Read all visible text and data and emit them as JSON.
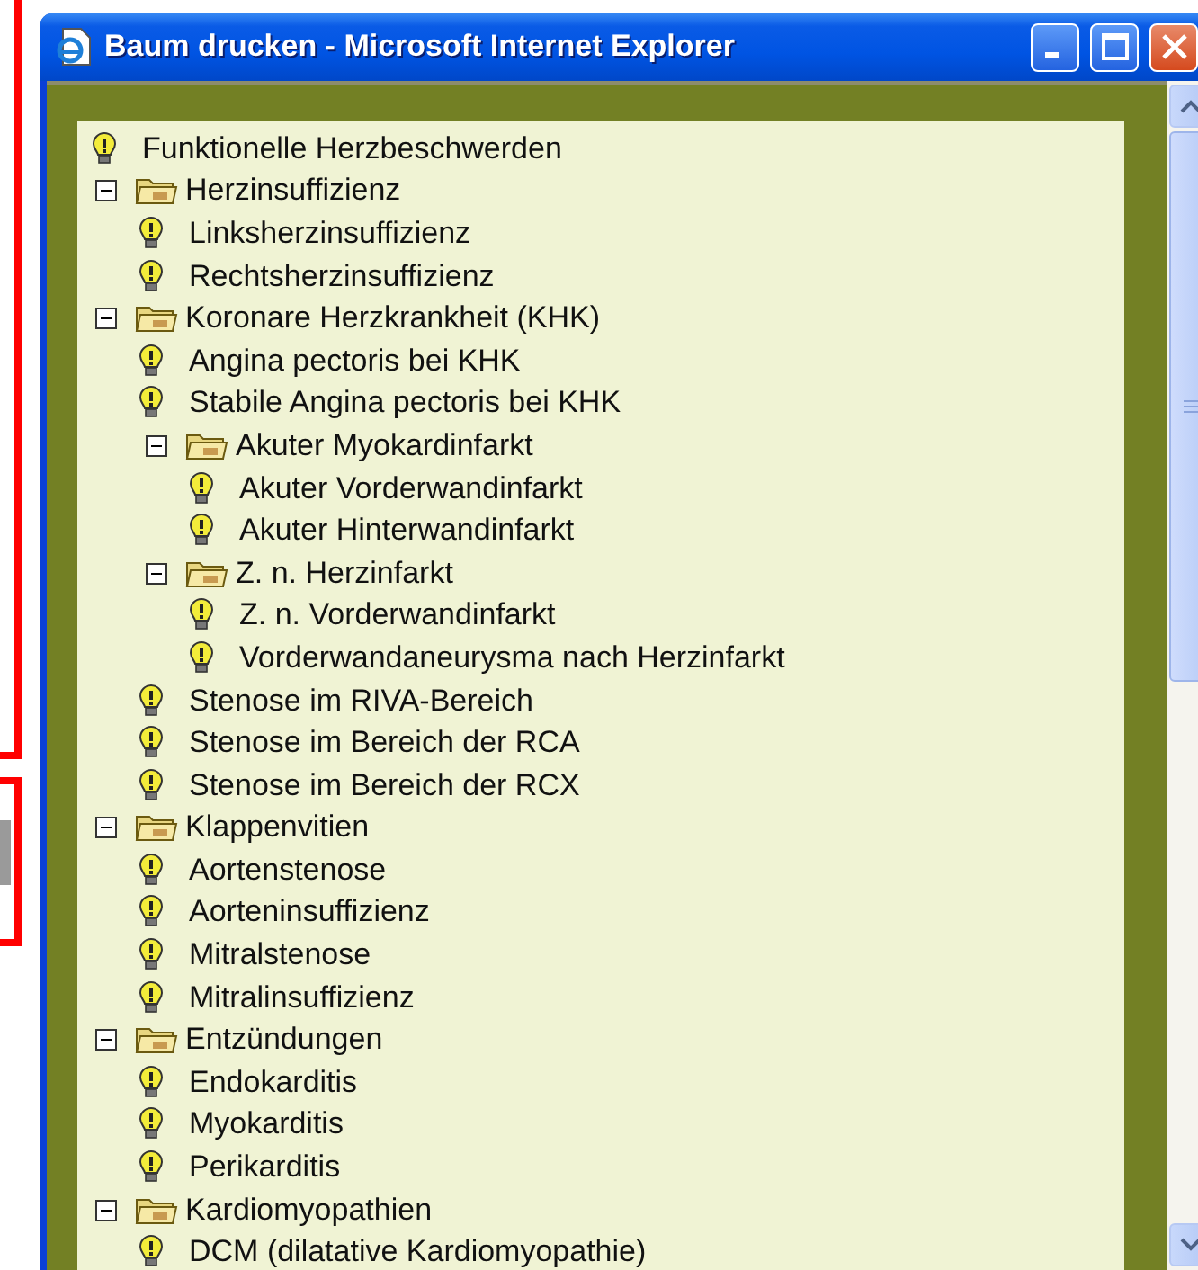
{
  "window": {
    "title": "Baum drucken - Microsoft Internet Explorer"
  },
  "tree": [
    {
      "kind": "leaf",
      "label": "Funktionelle Herzbeschwerden"
    },
    {
      "kind": "folder",
      "label": "Herzinsuffizienz",
      "expanded": true,
      "children": [
        {
          "kind": "leaf",
          "label": "Linksherzinsuffizienz"
        },
        {
          "kind": "leaf",
          "label": "Rechtsherzinsuffizienz"
        }
      ]
    },
    {
      "kind": "folder",
      "label": "Koronare Herzkrankheit (KHK)",
      "expanded": true,
      "children": [
        {
          "kind": "leaf",
          "label": "Angina pectoris bei KHK"
        },
        {
          "kind": "leaf",
          "label": "Stabile Angina pectoris bei KHK"
        },
        {
          "kind": "folder",
          "label": "Akuter Myokardinfarkt",
          "expanded": true,
          "children": [
            {
              "kind": "leaf",
              "label": "Akuter Vorderwandinfarkt"
            },
            {
              "kind": "leaf",
              "label": "Akuter Hinterwandinfarkt"
            }
          ]
        },
        {
          "kind": "folder",
          "label": "Z. n. Herzinfarkt",
          "expanded": true,
          "children": [
            {
              "kind": "leaf",
              "label": "Z. n. Vorderwandinfarkt"
            },
            {
              "kind": "leaf",
              "label": "Vorderwandaneurysma nach Herzinfarkt"
            }
          ]
        },
        {
          "kind": "leaf",
          "label": "Stenose im RIVA-Bereich"
        },
        {
          "kind": "leaf",
          "label": "Stenose im Bereich der RCA"
        },
        {
          "kind": "leaf",
          "label": "Stenose im Bereich der RCX"
        }
      ]
    },
    {
      "kind": "folder",
      "label": "Klappenvitien",
      "expanded": true,
      "children": [
        {
          "kind": "leaf",
          "label": "Aortenstenose"
        },
        {
          "kind": "leaf",
          "label": "Aorteninsuffizienz"
        },
        {
          "kind": "leaf",
          "label": "Mitralstenose"
        },
        {
          "kind": "leaf",
          "label": "Mitralinsuffizienz"
        }
      ]
    },
    {
      "kind": "folder",
      "label": "Entzündungen",
      "expanded": true,
      "children": [
        {
          "kind": "leaf",
          "label": "Endokarditis"
        },
        {
          "kind": "leaf",
          "label": "Myokarditis"
        },
        {
          "kind": "leaf",
          "label": "Perikarditis"
        }
      ]
    },
    {
      "kind": "folder",
      "label": "Kardiomyopathien",
      "expanded": true,
      "children": [
        {
          "kind": "leaf",
          "label": "DCM (dilatative Kardiomyopathie)"
        }
      ]
    }
  ]
}
